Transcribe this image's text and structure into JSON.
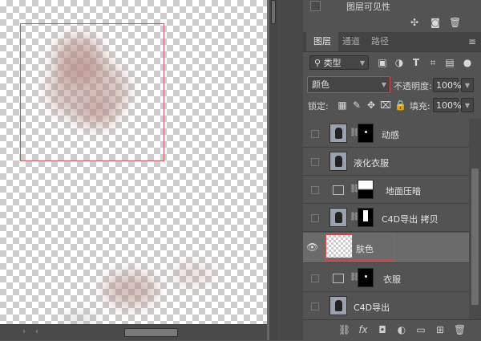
{
  "properties": {
    "visibility_label": "图层可见性"
  },
  "panel": {
    "tabs": [
      {
        "label": "图层",
        "active": true
      },
      {
        "label": "通道",
        "active": false
      },
      {
        "label": "路径",
        "active": false
      }
    ],
    "filter": {
      "kind_label": "类型"
    },
    "blend_mode": "颜色",
    "opacity_label": "不透明度:",
    "opacity_value": "100%",
    "lock_label": "锁定:",
    "fill_label": "填充:",
    "fill_value": "100%"
  },
  "layers": [
    {
      "name": "动感",
      "visible": false,
      "selected": false
    },
    {
      "name": "液化衣服",
      "visible": false,
      "selected": false
    },
    {
      "name": "地面压暗",
      "visible": false,
      "selected": false
    },
    {
      "name": "C4D导出 拷贝",
      "visible": false,
      "selected": false
    },
    {
      "name": "肤色",
      "visible": true,
      "selected": true
    },
    {
      "name": "衣服",
      "visible": false,
      "selected": false
    },
    {
      "name": "C4D导出",
      "visible": false,
      "selected": false
    }
  ],
  "colors": {
    "highlight_border": "#d9434a",
    "selection_rect": "#c9575f",
    "selected_layer_bg": "#6b6b6b"
  },
  "icons": {
    "bottom_bar": [
      "link-icon",
      "fx-icon",
      "mask-icon",
      "adjustment-icon",
      "folder-icon",
      "new-layer-icon",
      "trash-icon"
    ]
  }
}
